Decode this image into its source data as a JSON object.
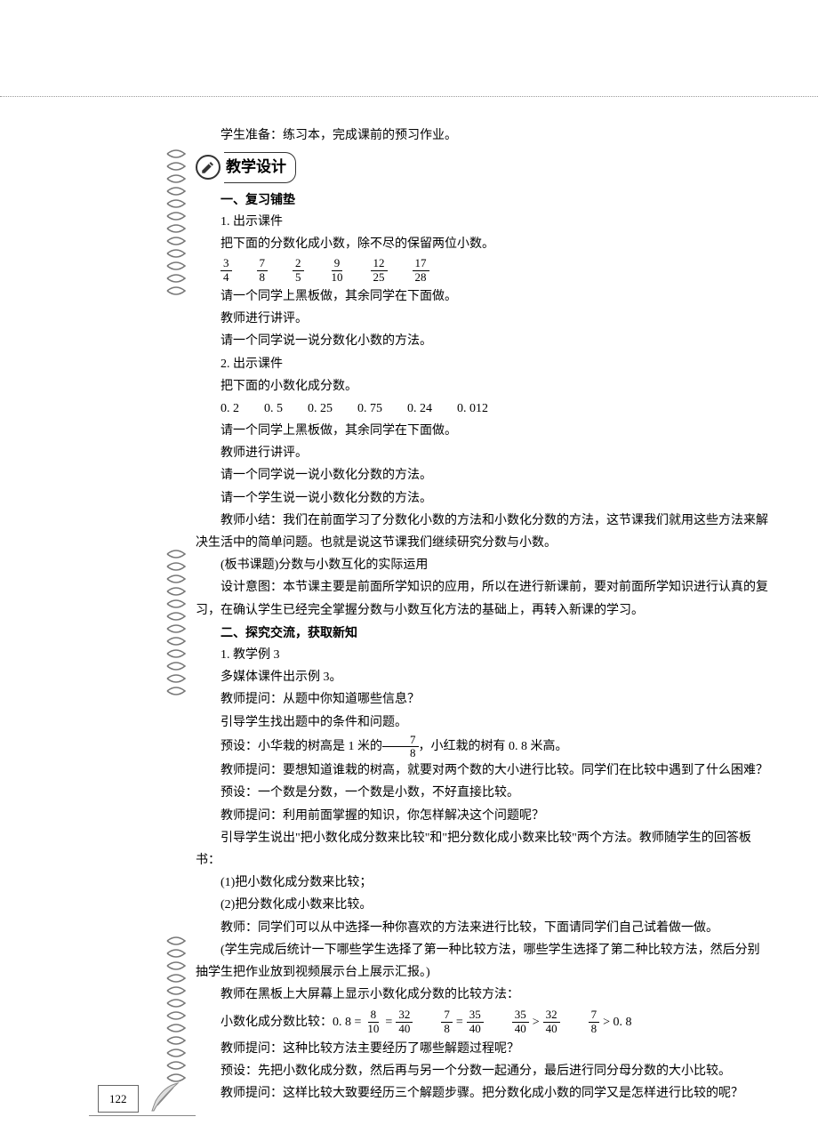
{
  "top_line": "学生准备：练习本，完成课前的预习作业。",
  "section_design": "教学设计",
  "sec1_title": "一、复习铺垫",
  "sec1_item1": "1. 出示课件",
  "sec1_p1": "把下面的分数化成小数，除不尽的保留两位小数。",
  "fracs1": [
    {
      "n": "3",
      "d": "4"
    },
    {
      "n": "7",
      "d": "8"
    },
    {
      "n": "2",
      "d": "5"
    },
    {
      "n": "9",
      "d": "10"
    },
    {
      "n": "12",
      "d": "25"
    },
    {
      "n": "17",
      "d": "28"
    }
  ],
  "sec1_p2": "请一个同学上黑板做，其余同学在下面做。",
  "sec1_p3": "教师进行讲评。",
  "sec1_p4": "请一个同学说一说分数化小数的方法。",
  "sec1_item2": "2. 出示课件",
  "sec1_p5": "把下面的小数化成分数。",
  "decimals": "0. 2　　0. 5　　0. 25　　0. 75　　0. 24　　0. 012",
  "sec1_p6": "请一个同学上黑板做，其余同学在下面做。",
  "sec1_p7": "教师进行讲评。",
  "sec1_p8": "请一个同学说一说小数化分数的方法。",
  "sec1_p9": "请一个学生说一说小数化分数的方法。",
  "sec1_summary": "教师小结：我们在前面学习了分数化小数的方法和小数化分数的方法，这节课我们就用这些方法来解决生活中的简单问题。也就是说这节课我们继续研究分数与小数。",
  "sec1_board": "(板书课题)分数与小数互化的实际运用",
  "sec1_intent": "设计意图：本节课主要是前面所学知识的应用，所以在进行新课前，要对前面所学知识进行认真的复习，在确认学生已经完全掌握分数与小数互化方法的基础上，再转入新课的学习。",
  "sec2_title": "二、探究交流，获取新知",
  "sec2_item1": "1. 教学例 3",
  "sec2_p1": "多媒体课件出示例 3。",
  "sec2_p2": "教师提问：从题中你知道哪些信息？",
  "sec2_p3": "引导学生找出题中的条件和问题。",
  "sec2_preset_pre": "预设：小华栽的树高是 1 米的",
  "sec2_preset_frac": {
    "n": "7",
    "d": "8"
  },
  "sec2_preset_post": "，小红栽的树有 0. 8 米高。",
  "sec2_p4": "教师提问：要想知道谁栽的树高，就要对两个数的大小进行比较。同学们在比较中遇到了什么困难？",
  "sec2_p5": "预设：一个数是分数，一个数是小数，不好直接比较。",
  "sec2_p6": "教师提问：利用前面掌握的知识，你怎样解决这个问题呢？",
  "sec2_p7": "引导学生说出\"把小数化成分数来比较\"和\"把分数化成小数来比较\"两个方法。教师随学生的回答板书：",
  "sec2_m1": "(1)把小数化成分数来比较；",
  "sec2_m2": "(2)把分数化成小数来比较。",
  "sec2_p8": "教师：同学们可以从中选择一种你喜欢的方法来进行比较，下面请同学们自己试着做一做。",
  "sec2_p9": "(学生完成后统计一下哪些学生选择了第一种比较方法，哪些学生选择了第二种比较方法，然后分别抽学生把作业放到视频展示台上展示汇报。)",
  "sec2_p10": "教师在黑板上大屏幕上显示小数化成分数的比较方法：",
  "math_label": "小数化成分数比较：0. 8 =",
  "math_f1": {
    "n": "8",
    "d": "10"
  },
  "math_eq1": "=",
  "math_f2": {
    "n": "32",
    "d": "40"
  },
  "math_f3": {
    "n": "7",
    "d": "8"
  },
  "math_eq2": "=",
  "math_f4": {
    "n": "35",
    "d": "40"
  },
  "math_f5": {
    "n": "35",
    "d": "40"
  },
  "math_gt": ">",
  "math_f6": {
    "n": "32",
    "d": "40"
  },
  "math_f7": {
    "n": "7",
    "d": "8"
  },
  "math_gt2": "> 0. 8",
  "sec2_p11": "教师提问：这种比较方法主要经历了哪些解题过程呢？",
  "sec2_p12": "预设：先把小数化成分数，然后再与另一个分数一起通分，最后进行同分母分数的大小比较。",
  "sec2_p13": "教师提问：这样比较大致要经历三个解题步骤。把分数化成小数的同学又是怎样进行比较的呢？",
  "page_number": "122"
}
